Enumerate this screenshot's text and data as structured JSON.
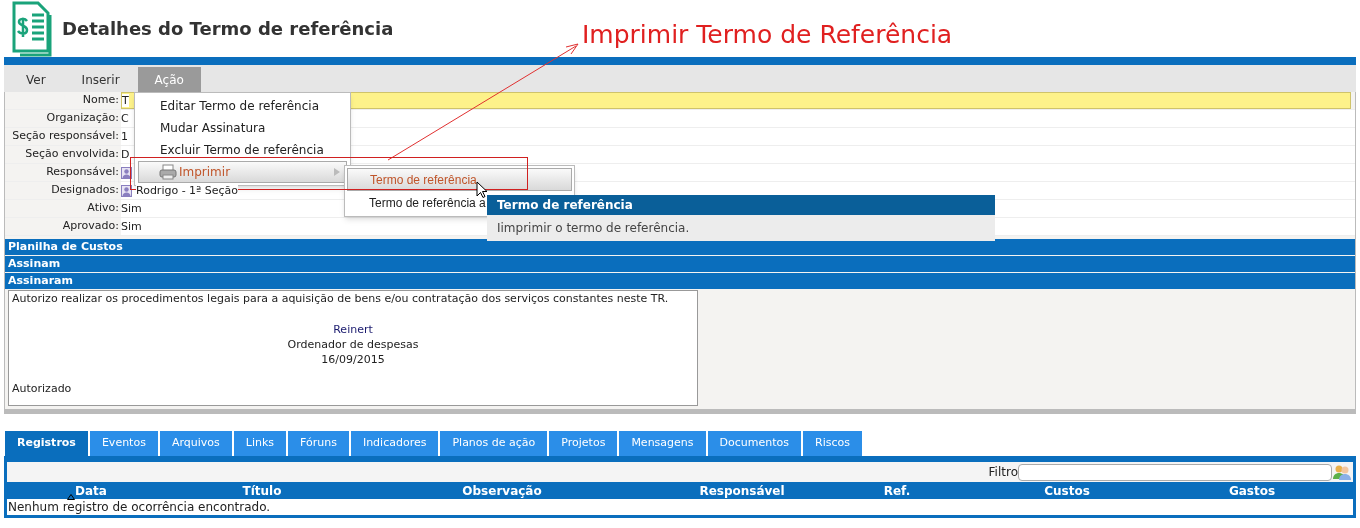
{
  "page": {
    "title": "Detalhes do Termo de referência"
  },
  "annotation": {
    "text": "Imprimir Termo de Referência"
  },
  "menubar": [
    {
      "label": "Ver",
      "selected": false
    },
    {
      "label": "Inserir",
      "selected": false
    },
    {
      "label": "Ação",
      "selected": true
    }
  ],
  "action_menu": [
    {
      "label": "Editar Termo de referência",
      "selected": false,
      "kind": "item"
    },
    {
      "label": "Mudar Assinatura",
      "selected": false,
      "kind": "item"
    },
    {
      "label": "Excluir Termo de referência",
      "selected": false,
      "kind": "item"
    },
    {
      "label": "Imprimir",
      "selected": true,
      "kind": "submenu"
    }
  ],
  "print_submenu": [
    {
      "label": "Termo de referência",
      "selected": true
    },
    {
      "label": "Termo de referência a",
      "selected": false
    }
  ],
  "tooltip": {
    "title": "Termo de referência",
    "text": "Iimprimir o termo de referência."
  },
  "fields": [
    {
      "label": "Nome:",
      "value": "T",
      "kind": "highlight"
    },
    {
      "label": "Organização:",
      "value": "C",
      "kind": "text"
    },
    {
      "label": "Seção responsável:",
      "value": "1",
      "kind": "text"
    },
    {
      "label": "Seção envolvida:",
      "value": "D",
      "kind": "text"
    },
    {
      "label": "Responsável:",
      "kind": "person"
    },
    {
      "label": "Designados:",
      "value": "Rodrigo - 1ª Seção",
      "kind": "person"
    },
    {
      "label": "Ativo:",
      "value": "Sim",
      "kind": "text"
    },
    {
      "label": "Aprovado:",
      "value": "Sim",
      "kind": "text"
    }
  ],
  "sections": [
    "Planilha de Custos",
    "Assinam",
    "Assinaram"
  ],
  "signature": {
    "statement": "Autorizo realizar os procedimentos legais para a aquisição de bens e/ou contratação dos serviços constantes neste TR.",
    "name": "Reinert",
    "role": "Ordenador de despesas",
    "date": "16/09/2015",
    "status": "Autorizado"
  },
  "tabs": [
    {
      "label": "Registros",
      "selected": true
    },
    {
      "label": "Eventos",
      "selected": false
    },
    {
      "label": "Arquivos",
      "selected": false
    },
    {
      "label": "Links",
      "selected": false
    },
    {
      "label": "Fóruns",
      "selected": false
    },
    {
      "label": "Indicadores",
      "selected": false
    },
    {
      "label": "Planos de ação",
      "selected": false
    },
    {
      "label": "Projetos",
      "selected": false
    },
    {
      "label": "Mensagens",
      "selected": false
    },
    {
      "label": "Documentos",
      "selected": false
    },
    {
      "label": "Riscos",
      "selected": false
    }
  ],
  "filter": {
    "label": "Filtro"
  },
  "table": {
    "columns": [
      {
        "label": "Data",
        "sorted": true
      },
      {
        "label": "Título",
        "sorted": false
      },
      {
        "label": "Observação",
        "sorted": false
      },
      {
        "label": "Responsável",
        "sorted": false
      },
      {
        "label": "Ref.",
        "sorted": false
      },
      {
        "label": "Custos",
        "sorted": false
      },
      {
        "label": "Gastos",
        "sorted": false
      }
    ],
    "empty_message": "Nenhum registro de ocorrência encontrado."
  }
}
